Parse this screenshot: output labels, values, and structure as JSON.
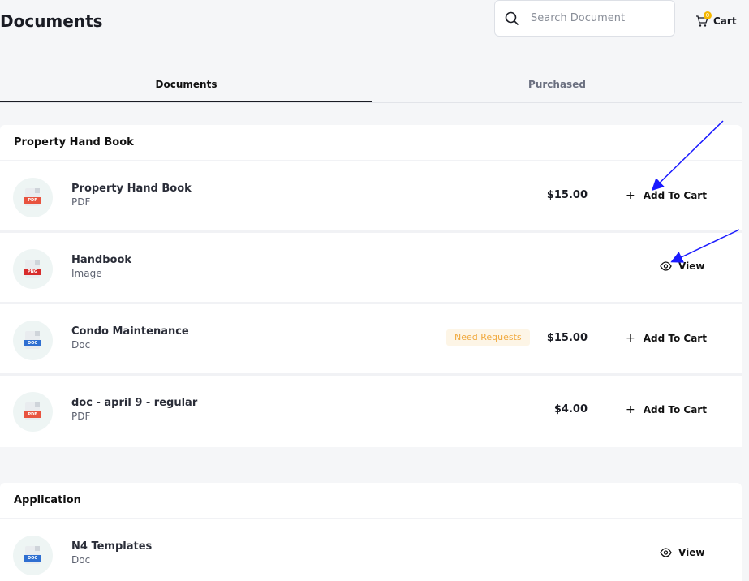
{
  "header": {
    "title": "Documents",
    "search_placeholder": "Search Document",
    "search_value": "",
    "cart_label": "Cart",
    "cart_count": "0"
  },
  "tabs": [
    {
      "label": "Documents",
      "active": true
    },
    {
      "label": "Purchased",
      "active": false
    }
  ],
  "sections": [
    {
      "title": "Property Hand Book",
      "rows": [
        {
          "title": "Property Hand Book",
          "type": "PDF",
          "file_tag": "PDF",
          "price": "$15.00",
          "action": "Add To Cart"
        },
        {
          "title": "Handbook",
          "type": "Image",
          "file_tag": "PNG",
          "price": "",
          "action": "View"
        },
        {
          "title": "Condo Maintenance",
          "type": "Doc",
          "file_tag": "DOC",
          "badge": "Need Requests",
          "price": "$15.00",
          "action": "Add To Cart"
        },
        {
          "title": "doc - april 9 - regular",
          "type": "PDF",
          "file_tag": "PDF",
          "price": "$4.00",
          "action": "Add To Cart"
        }
      ]
    },
    {
      "title": "Application",
      "rows": [
        {
          "title": "N4 Templates",
          "type": "Doc",
          "file_tag": "DOC",
          "price": "",
          "action": "View"
        }
      ]
    }
  ],
  "colors": {
    "pdf_tag": "#e8533f",
    "png_tag": "#d72c2c",
    "doc_tag": "#2f6fd1",
    "badge_bg": "#fdf5e6",
    "badge_text": "#f0a83c",
    "annotation_arrow": "#1a1aff"
  },
  "icons": {
    "search": "search-icon",
    "cart": "cart-icon",
    "plus": "plus-icon",
    "view": "eye-icon",
    "file": "file-icon"
  }
}
